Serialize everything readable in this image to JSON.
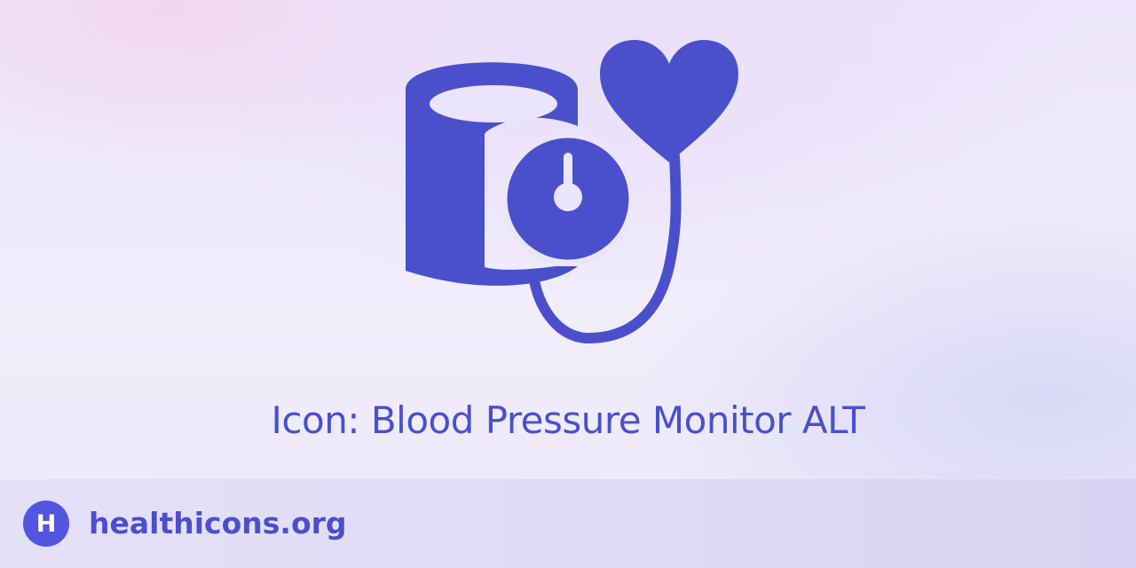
{
  "hero": {
    "icon_name": "blood-pressure-monitor-alt-icon",
    "icon_color": "#4a50cc",
    "title": "Icon: Blood Pressure Monitor ALT"
  },
  "footer": {
    "logo_icon": "healthicons-logo-icon",
    "logo_letter": "H",
    "logo_color": "#5155e0",
    "site": "healthicons.org"
  }
}
